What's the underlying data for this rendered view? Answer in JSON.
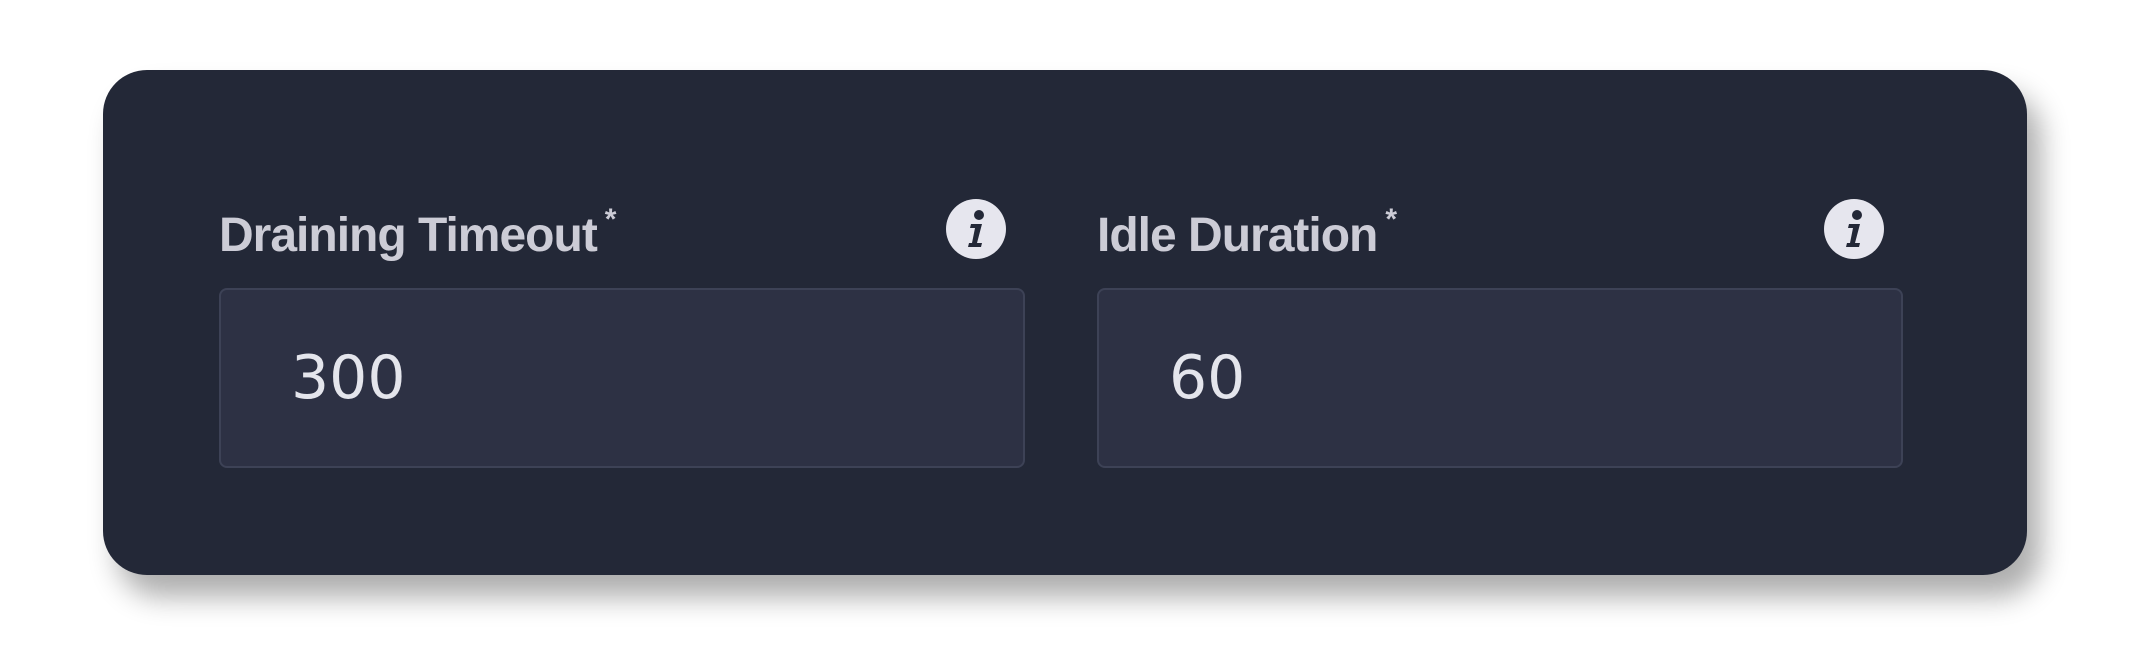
{
  "fields": [
    {
      "label": "Draining Timeout",
      "required_mark": "*",
      "value": "300",
      "icon": "info-icon"
    },
    {
      "label": "Idle Duration",
      "required_mark": "*",
      "value": "60",
      "icon": "info-icon"
    }
  ],
  "colors": {
    "card_bg": "#232837",
    "input_bg": "#2d3144",
    "label": "#ccccd6",
    "value": "#e4e5ec"
  }
}
